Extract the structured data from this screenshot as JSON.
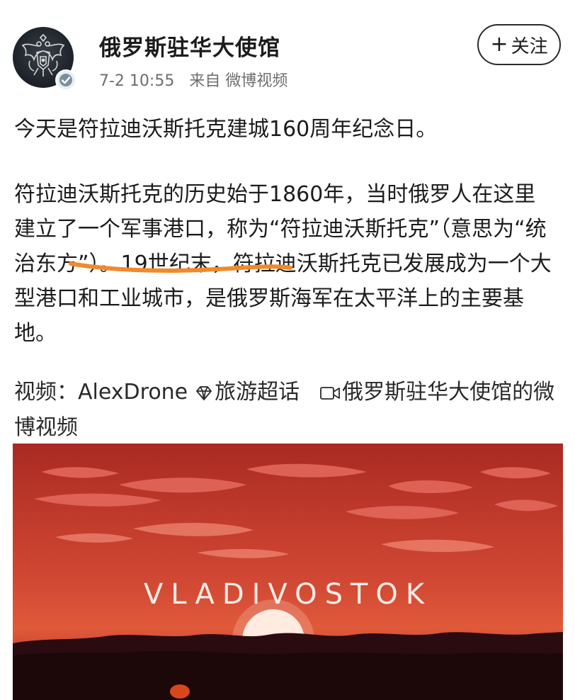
{
  "account": {
    "name": "俄罗斯驻华大使馆",
    "date": "7-2 10:55",
    "source": "来自 微博视频",
    "follow_label": "关注",
    "follow_plus": "+"
  },
  "post": {
    "line1": "今天是符拉迪沃斯托克建城160周年纪念日。",
    "para2_a": "符拉迪沃斯托克的历史始于1860年，当时俄罗人在这里建立了一个军事港口，称为“符拉迪沃斯托克”（",
    "para2_highlight": "意思为“统治东方”",
    "para2_b": "）。19世纪末，符拉迪沃斯托克已发展成为一个大型港口和工业城市，是俄罗斯海军在太平洋上的主要基地。"
  },
  "links": {
    "video_prefix": "视频：AlexDrone",
    "topic": "旅游超话",
    "video_source": "俄罗斯驻华大使馆的微博视频"
  },
  "video": {
    "title": "VLADIVOSTOK"
  },
  "colors": {
    "underline": "#f08a2a",
    "verified": "#7a8f9e",
    "sky": "#c13b2c"
  }
}
